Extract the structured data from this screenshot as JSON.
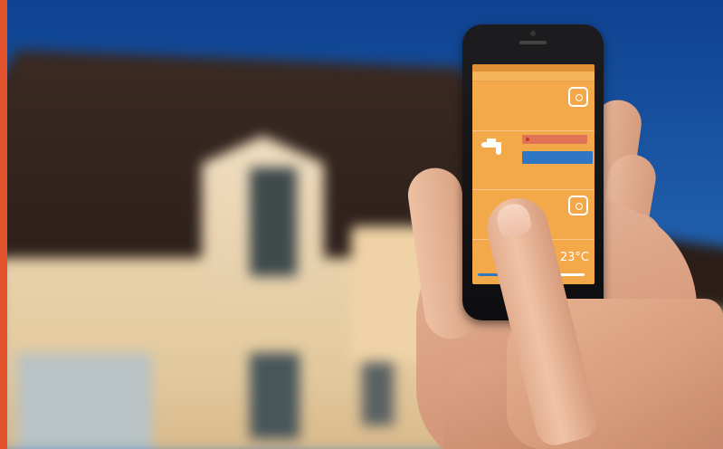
{
  "colors": {
    "accent_strip": "#e2522c",
    "app_background": "#f3a94a",
    "status_chip": "#e07455",
    "action_button": "#2f76c4"
  },
  "app": {
    "title": "",
    "sections": [
      {
        "label": "",
        "sub": "",
        "tag": "",
        "icon": "room-icon"
      },
      {
        "label": "",
        "sub": "",
        "tag": "",
        "icon": "room-icon"
      }
    ],
    "water": {
      "icon": "faucet-icon",
      "status_text": "",
      "action_label": ""
    },
    "temperature": {
      "label": "",
      "value": "23°C",
      "slider_fraction": 0.6
    }
  }
}
